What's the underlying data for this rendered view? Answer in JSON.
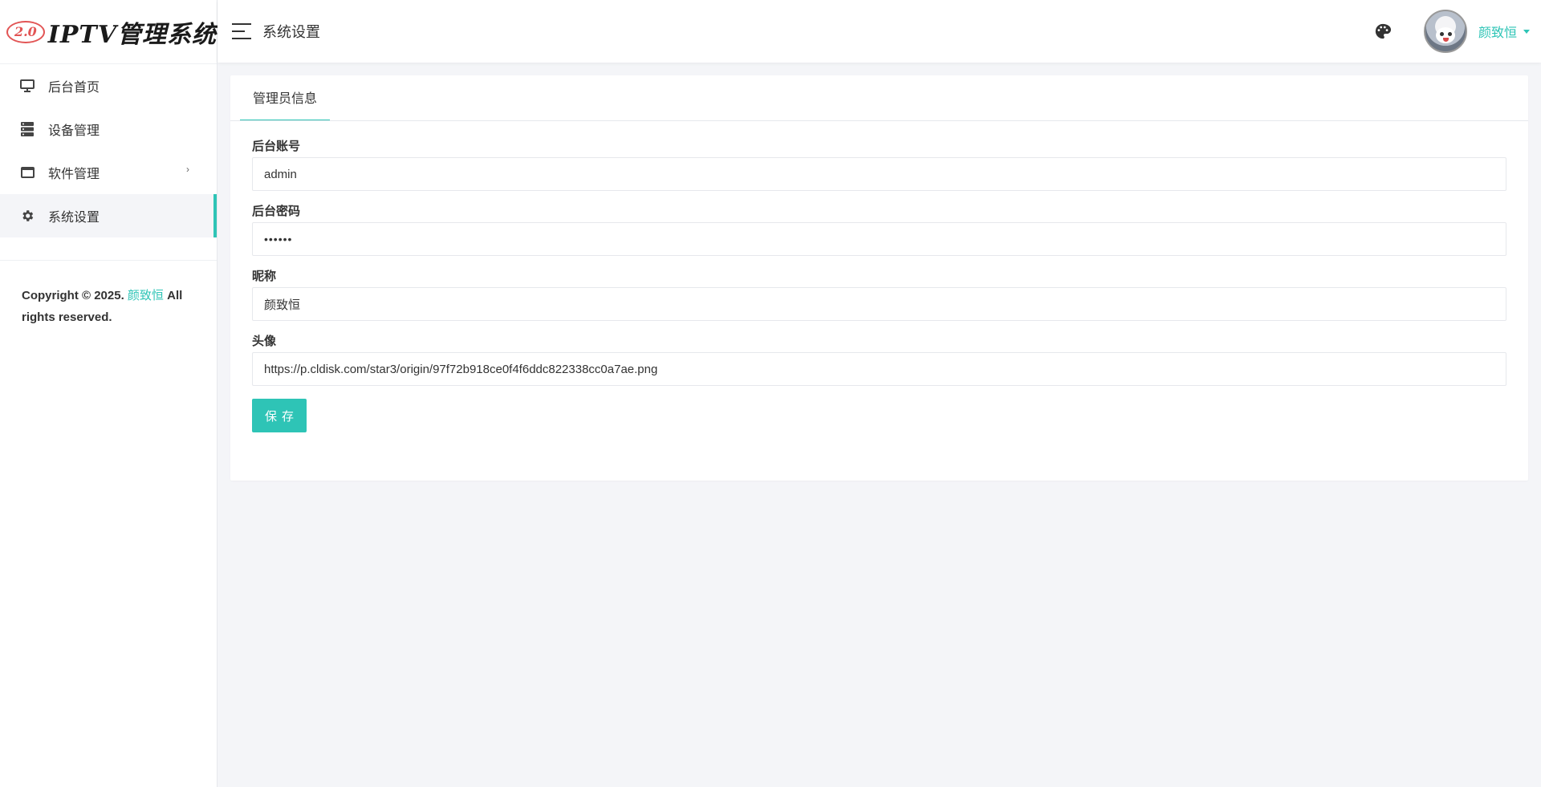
{
  "logo": {
    "badge": "2.0",
    "title": "IPTV管理系统"
  },
  "sidebar": {
    "items": [
      {
        "label": "后台首页",
        "icon": "monitor-icon"
      },
      {
        "label": "设备管理",
        "icon": "server-icon"
      },
      {
        "label": "软件管理",
        "icon": "window-icon",
        "arrow": "›"
      },
      {
        "label": "系统设置",
        "icon": "gear-icon"
      }
    ],
    "copyright": {
      "prefix": "Copyright © 2025. ",
      "author": "颜致恒",
      "suffix": " All rights reserved."
    }
  },
  "header": {
    "title": "系统设置",
    "username": "颜致恒"
  },
  "card": {
    "tab": "管理员信息",
    "fields": [
      {
        "label": "后台账号",
        "value": "admin"
      },
      {
        "label": "后台密码",
        "value": "••••••"
      },
      {
        "label": "昵称",
        "value": "颜致恒"
      },
      {
        "label": "头像",
        "value": "https://p.cldisk.com/star3/origin/97f72b918ce0f4f6ddc822338cc0a7ae.png"
      }
    ],
    "save_label": "保存"
  },
  "colors": {
    "accent": "#2ec4b6",
    "logo_badge": "#e25555"
  }
}
